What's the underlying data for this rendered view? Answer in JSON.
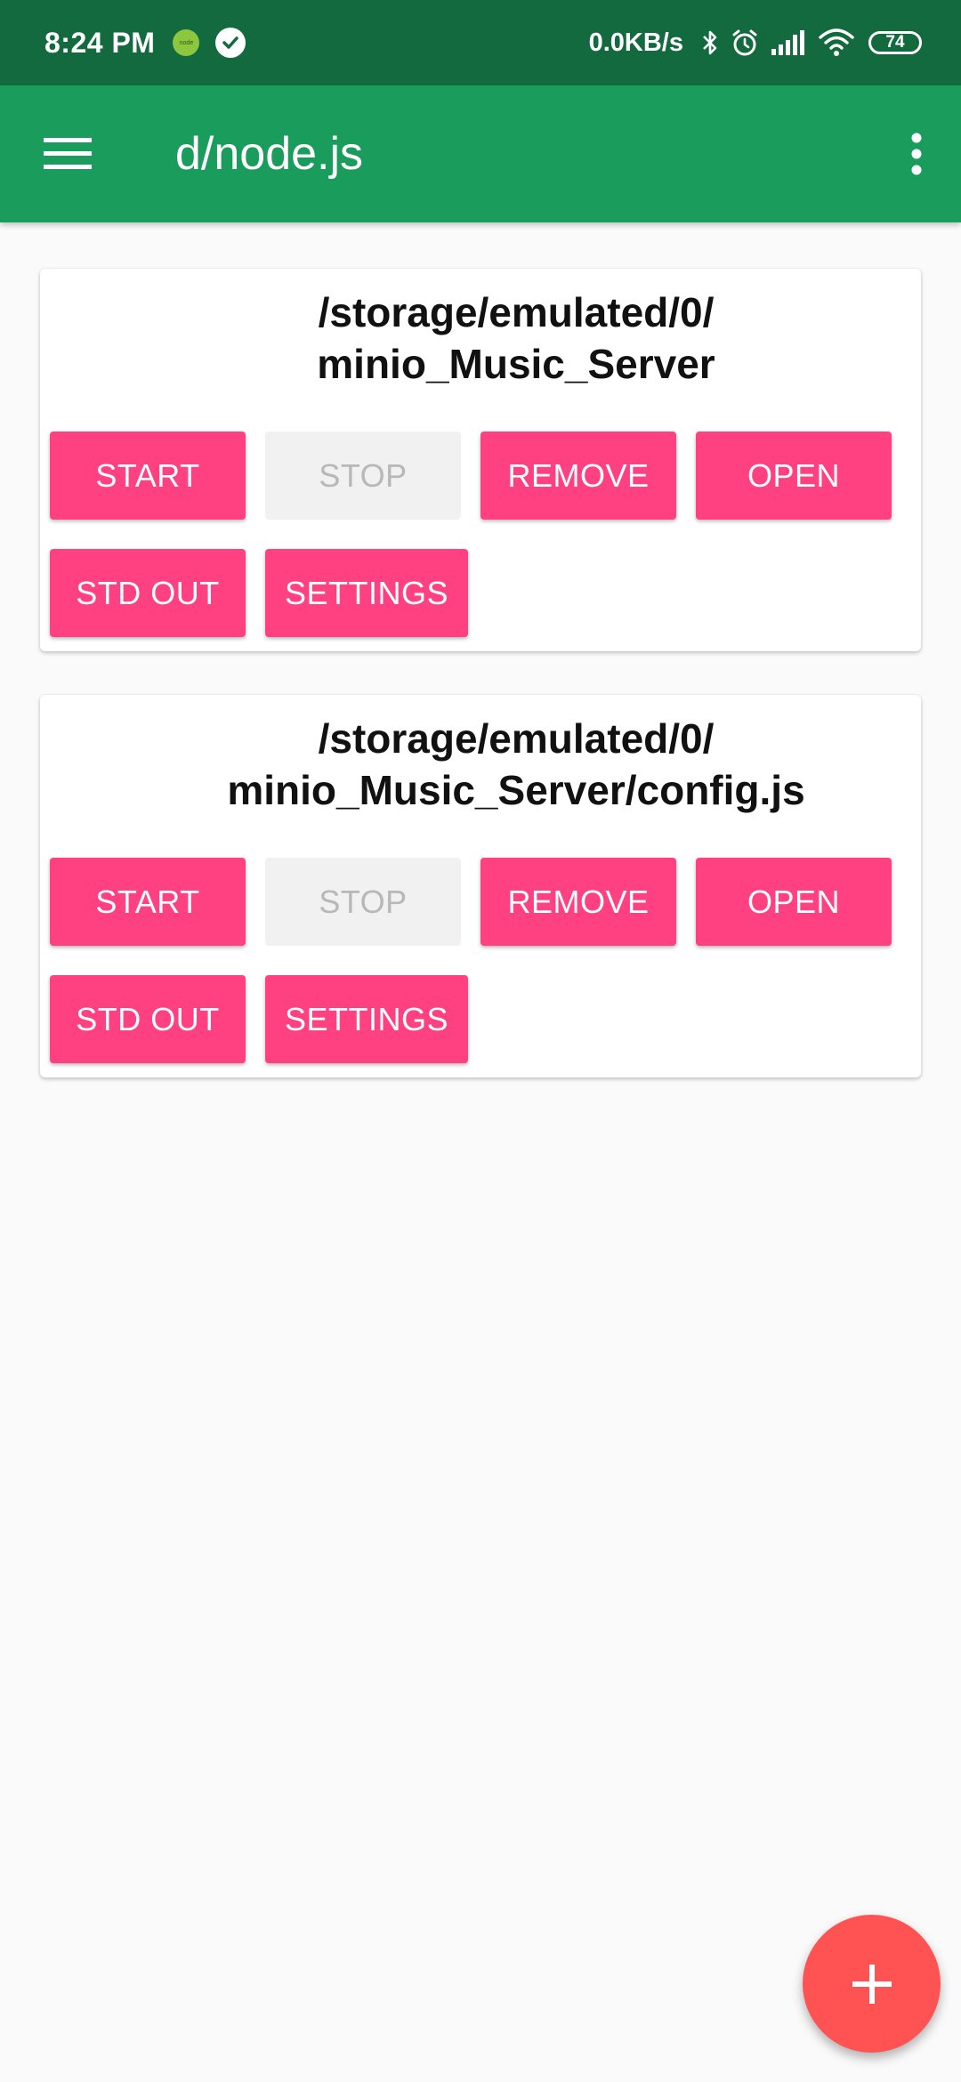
{
  "status_bar": {
    "time": "8:24 PM",
    "node_badge": "node",
    "network_speed": "0.0KB/s",
    "battery_level": "74",
    "icons": [
      "node-icon",
      "check-circle-icon",
      "bluetooth-icon",
      "alarm-icon",
      "signal-icon",
      "wifi-icon",
      "battery-icon"
    ]
  },
  "app_bar": {
    "title": "d/node.js",
    "menu_icon": "hamburger-menu-icon",
    "overflow_icon": "more-vert-icon"
  },
  "projects": [
    {
      "path_line1": "/storage/emulated/0/",
      "path_line2": "minio_Music_Server",
      "buttons": {
        "start": "START",
        "stop": "STOP",
        "remove": "REMOVE",
        "open": "OPEN",
        "std_out": "STD OUT",
        "settings": "SETTINGS"
      },
      "stop_enabled": false
    },
    {
      "path_line1": "/storage/emulated/0/",
      "path_line2": "minio_Music_Server/config.js",
      "buttons": {
        "start": "START",
        "stop": "STOP",
        "remove": "REMOVE",
        "open": "OPEN",
        "std_out": "STD OUT",
        "settings": "SETTINGS"
      },
      "stop_enabled": false
    }
  ],
  "fab": {
    "icon": "plus-icon"
  },
  "colors": {
    "status_bar": "#136a3e",
    "app_bar": "#1a9d5c",
    "accent_button": "#ff4081",
    "disabled_button": "#f1f1f1",
    "fab": "#ff5252",
    "background": "#fafafa"
  }
}
